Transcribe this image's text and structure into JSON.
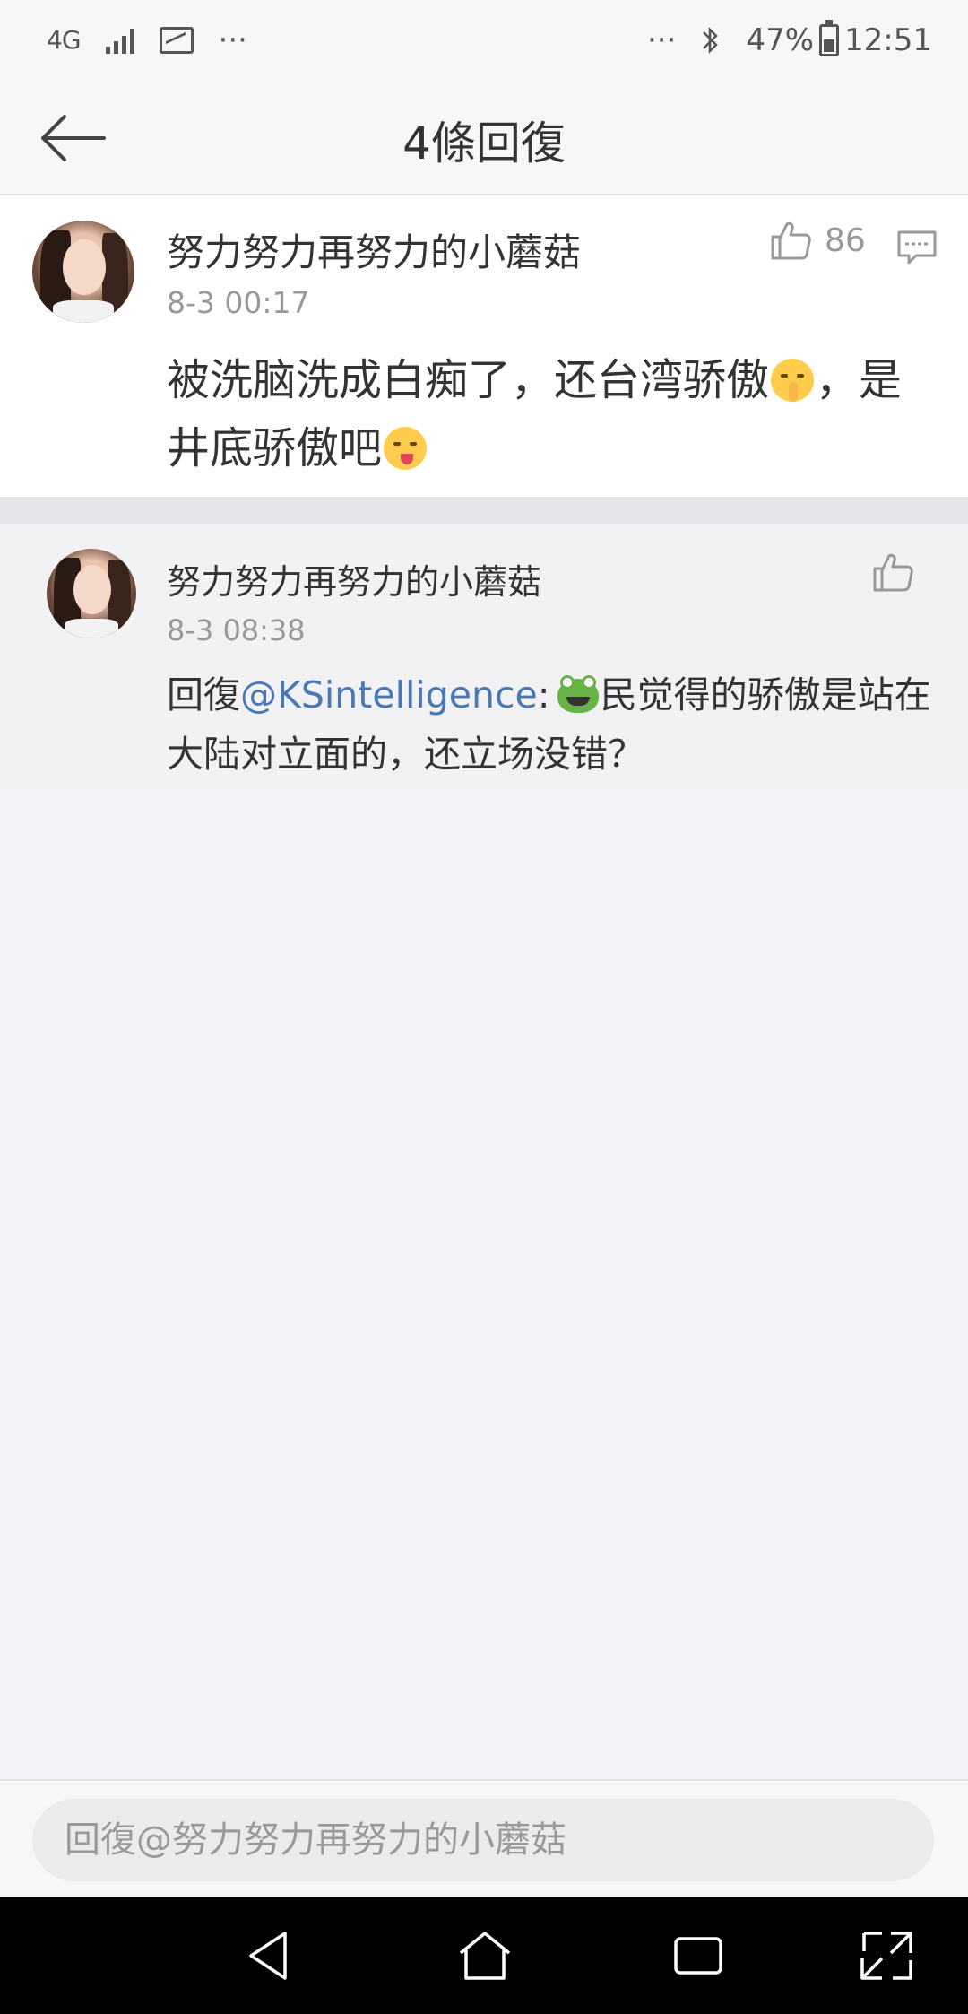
{
  "status_bar": {
    "network": "4G",
    "more_left": "···",
    "more_right": "···",
    "battery": "47%",
    "time": "12:51"
  },
  "header": {
    "title": "4條回復"
  },
  "main_comment": {
    "username": "努力努力再努力的小蘑菇",
    "timestamp": "8-3 00:17",
    "text_part1": "被洗脑洗成白痴了，还台湾骄傲",
    "text_part2": "，是井底骄傲吧",
    "like_count": "86"
  },
  "reply": {
    "username": "努力努力再努力的小蘑菇",
    "timestamp": "8-3 08:38",
    "prefix": "回復",
    "mention": "@KSintelligence",
    "colon": ":",
    "text": "民觉得的骄傲是站在大陆对立面的，还立场没错？"
  },
  "bottom_bar": {
    "placeholder": "回復@努力努力再努力的小蘑菇"
  },
  "colors": {
    "mention": "#4a78b5",
    "background": "#f3f3f8"
  }
}
